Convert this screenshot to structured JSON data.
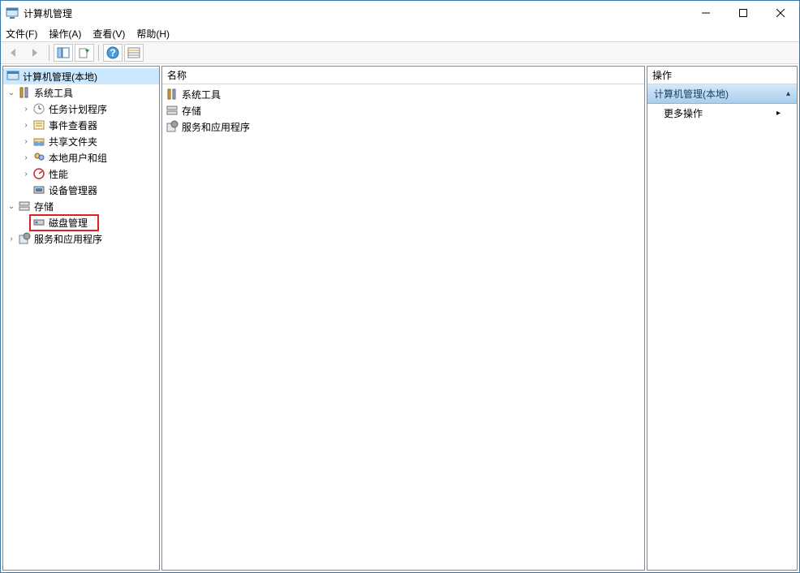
{
  "window": {
    "title": "计算机管理",
    "minimize_label": "Minimize",
    "maximize_label": "Maximize",
    "close_label": "Close"
  },
  "menubar": {
    "file": "文件(F)",
    "action": "操作(A)",
    "view": "查看(V)",
    "help": "帮助(H)"
  },
  "toolbar": {
    "back": "back",
    "forward": "forward",
    "show_hide_tree": "show-hide-tree",
    "export": "export",
    "refresh": "refresh",
    "help": "help",
    "grid": "grid"
  },
  "tree": {
    "root": "计算机管理(本地)",
    "system_tools": "系统工具",
    "task_scheduler": "任务计划程序",
    "event_viewer": "事件查看器",
    "shared_folders": "共享文件夹",
    "local_users_groups": "本地用户和组",
    "performance": "性能",
    "device_manager": "设备管理器",
    "storage": "存储",
    "disk_management": "磁盘管理",
    "services_apps": "服务和应用程序"
  },
  "list": {
    "header_name": "名称",
    "items": [
      "系统工具",
      "存储",
      "服务和应用程序"
    ]
  },
  "actions": {
    "header": "操作",
    "section_title": "计算机管理(本地)",
    "more_actions": "更多操作"
  }
}
